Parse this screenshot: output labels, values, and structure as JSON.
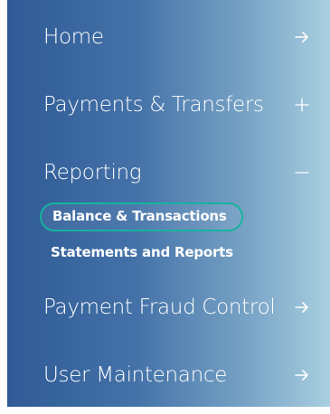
{
  "nav": {
    "items": [
      {
        "label": "Home",
        "icon": "arrow-right-icon"
      },
      {
        "label": "Payments & Transfers",
        "icon": "plus-icon"
      },
      {
        "label": "Reporting",
        "icon": "minus-icon"
      },
      {
        "label": "Payment Fraud Control",
        "icon": "arrow-right-icon"
      },
      {
        "label": "User Maintenance",
        "icon": "arrow-right-icon"
      }
    ],
    "reporting_sub": [
      {
        "label": "Balance & Transactions",
        "active": true
      },
      {
        "label": "Statements and Reports",
        "active": false
      }
    ]
  },
  "colors": {
    "gradient_start": "#2f5a96",
    "gradient_end": "#a9cfe0",
    "active_outline": "#17b39d",
    "text": "#ffffff"
  }
}
